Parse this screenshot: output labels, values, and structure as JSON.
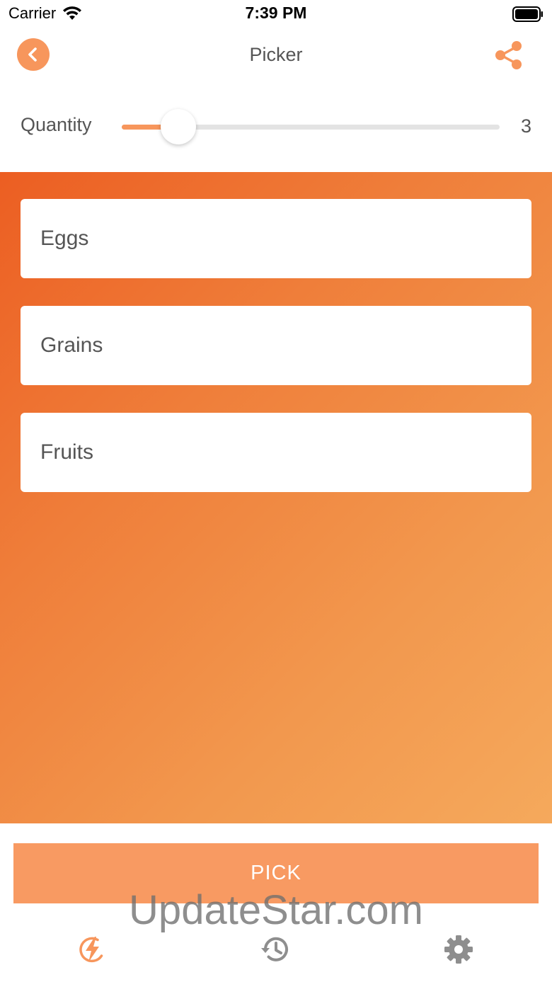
{
  "status_bar": {
    "carrier": "Carrier",
    "time": "7:39 PM"
  },
  "nav": {
    "title": "Picker",
    "back_icon": "chevron-left-icon",
    "share_icon": "share-icon"
  },
  "quantity": {
    "label": "Quantity",
    "value": "3",
    "slider_fraction": 0.15
  },
  "items": [
    {
      "label": "Eggs"
    },
    {
      "label": "Grains"
    },
    {
      "label": "Fruits"
    }
  ],
  "pick_button": {
    "label": "PICK"
  },
  "watermark": "UpdateStar.com",
  "tabs": [
    {
      "icon": "lightning-icon",
      "active": true
    },
    {
      "icon": "history-icon",
      "active": false
    },
    {
      "icon": "gear-icon",
      "active": false
    }
  ],
  "colors": {
    "accent": "#f7965c",
    "gradient_start": "#ec5e22",
    "gradient_end": "#f5a95c",
    "inactive_icon": "#8e8e8e"
  }
}
